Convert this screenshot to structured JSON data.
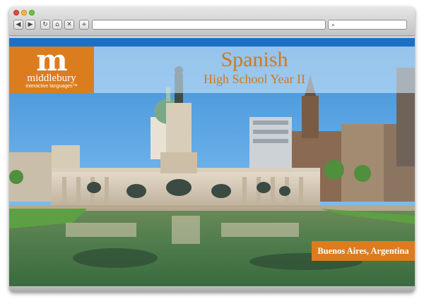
{
  "browser": {
    "toolbar": {
      "back_icon": "back-arrow-icon",
      "forward_icon": "forward-arrow-icon",
      "reload_icon": "reload-icon",
      "home_icon": "home-icon",
      "stop_icon": "close-icon",
      "new_tab_icon": "plus-icon",
      "search_icon": "search-icon",
      "address_value": "",
      "search_value": ""
    }
  },
  "page": {
    "logo": {
      "mark": "m",
      "name": "middlebury",
      "tagline": "interactive languages™"
    },
    "title": "Spanish",
    "subtitle": "High School Year II",
    "location": "Buenos Aires, Argentina"
  },
  "colors": {
    "accent_orange": "#db7d1f",
    "title_orange": "#d2781c",
    "nav_blue": "#1d6fc4"
  }
}
